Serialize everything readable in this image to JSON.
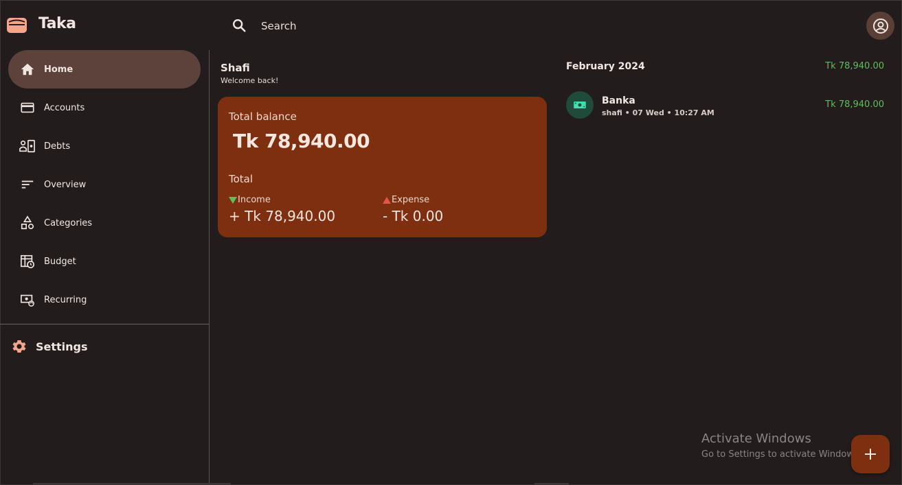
{
  "app": {
    "title": "Taka"
  },
  "search": {
    "placeholder": "Search"
  },
  "sidebar": {
    "items": [
      {
        "label": "Home",
        "icon": "home-icon",
        "active": true
      },
      {
        "label": "Accounts",
        "icon": "card-icon"
      },
      {
        "label": "Debts",
        "icon": "debts-icon"
      },
      {
        "label": "Overview",
        "icon": "sort-icon"
      },
      {
        "label": "Categories",
        "icon": "shapes-icon"
      },
      {
        "label": "Budget",
        "icon": "budget-icon"
      },
      {
        "label": "Recurring",
        "icon": "recurring-icon"
      }
    ],
    "settings_label": "Settings"
  },
  "main": {
    "user_name": "Shafi",
    "welcome": "Welcome back!",
    "balance_card": {
      "title": "Total balance",
      "amount": "Tk 78,940.00",
      "total_label": "Total",
      "income_label": "Income",
      "income_value": "+ Tk 78,940.00",
      "expense_label": "Expense",
      "expense_value": "- Tk 0.00"
    }
  },
  "transactions": {
    "month": "February 2024",
    "month_total": "Tk 78,940.00",
    "items": [
      {
        "title": "Banka",
        "subtitle": "shafi • 07 Wed • 10:27 AM",
        "amount": "Tk 78,940.00",
        "icon": "cash-icon"
      }
    ]
  },
  "watermark": {
    "title": "Activate Windows",
    "subtitle": "Go to Settings to activate Windows."
  },
  "colors": {
    "background": "#221d1c",
    "accent": "#7e2f10",
    "active_nav": "#5c423a",
    "income": "#5fbf5a",
    "expense": "#e2554c",
    "logo": "#f4a58a"
  }
}
